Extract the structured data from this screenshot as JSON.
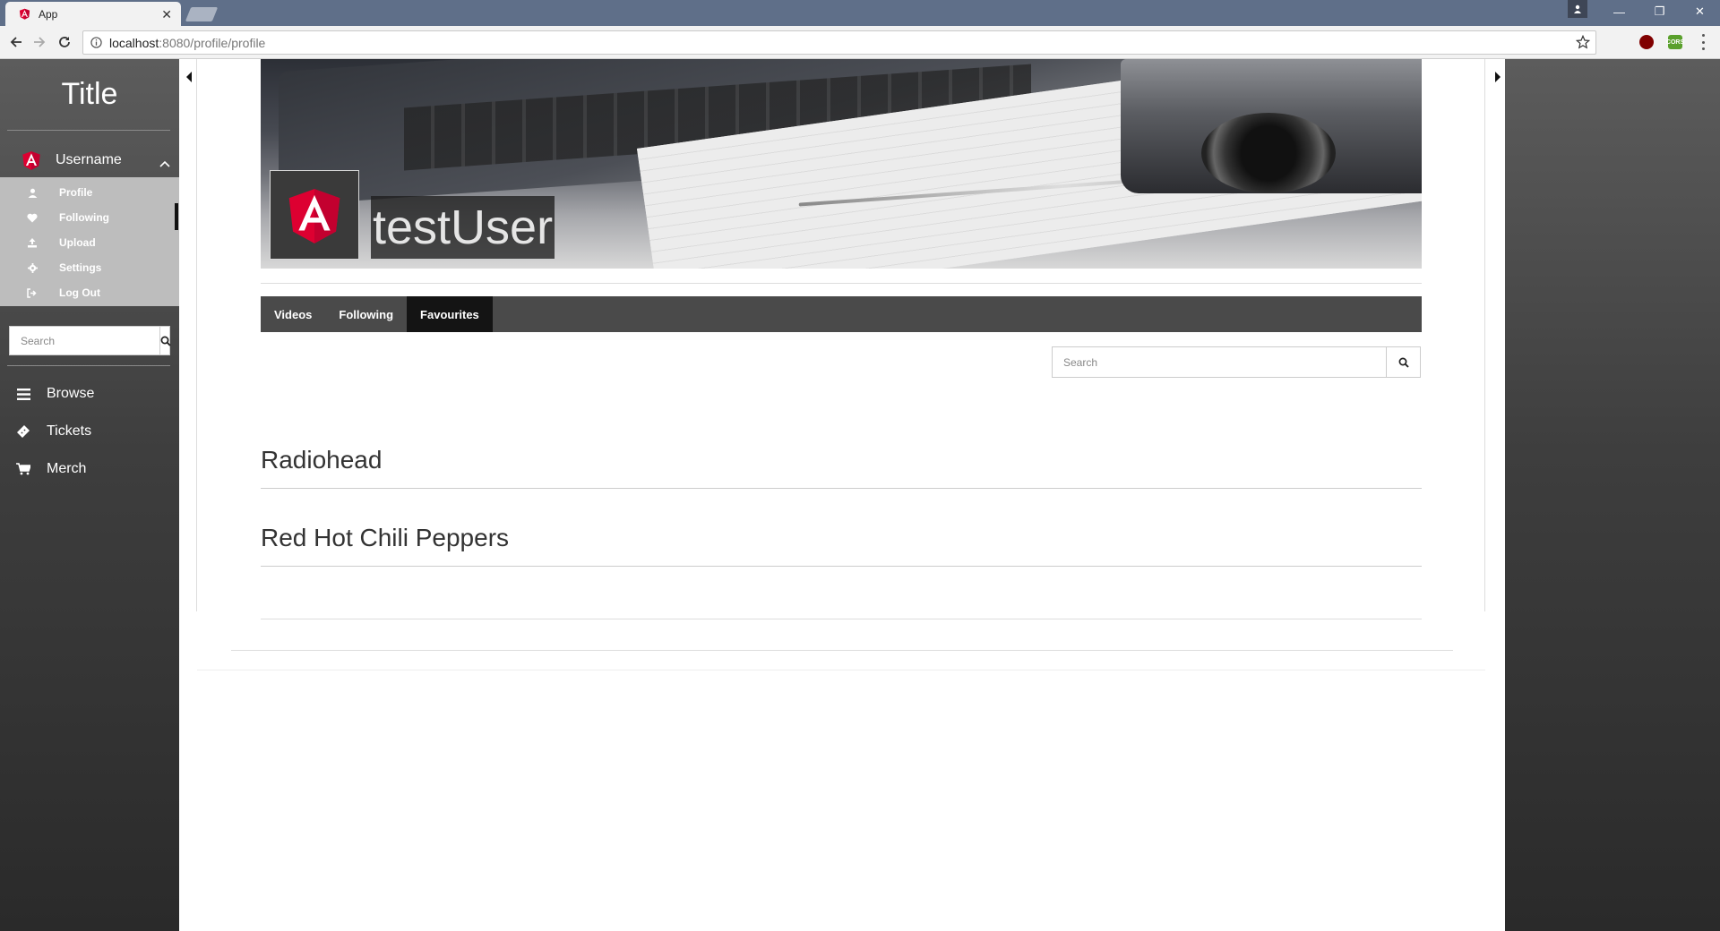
{
  "browser": {
    "tab_title": "App",
    "url_host": "localhost",
    "url_rest": ":8080/profile/profile",
    "ext_ublock": "",
    "ext_cors": "CORS",
    "win_min": "—",
    "win_restore": "❐",
    "win_close": "✕",
    "tab_close": "✕"
  },
  "sidebar": {
    "title": "Title",
    "username": "Username",
    "submenu": [
      {
        "label": "Profile",
        "icon": "user-icon"
      },
      {
        "label": "Following",
        "icon": "heart-icon"
      },
      {
        "label": "Upload",
        "icon": "upload-icon"
      },
      {
        "label": "Settings",
        "icon": "gear-icon"
      },
      {
        "label": "Log Out",
        "icon": "logout-icon"
      }
    ],
    "search_placeholder": "Search",
    "nav": [
      {
        "label": "Browse",
        "icon": "menu-icon"
      },
      {
        "label": "Tickets",
        "icon": "ticket-icon"
      },
      {
        "label": "Merch",
        "icon": "cart-icon"
      }
    ]
  },
  "profile": {
    "username": "testUser",
    "tabs": [
      {
        "label": "Videos",
        "active": false
      },
      {
        "label": "Following",
        "active": false
      },
      {
        "label": "Favourites",
        "active": true
      }
    ],
    "search_placeholder": "Search",
    "favourites": [
      "Radiohead",
      "Red Hot Chili Peppers"
    ]
  },
  "colors": {
    "angular_red": "#dd0031",
    "angular_dark_red": "#c3002f",
    "tabbar_bg": "#4a4a4a",
    "tab_active_bg": "#141414"
  }
}
